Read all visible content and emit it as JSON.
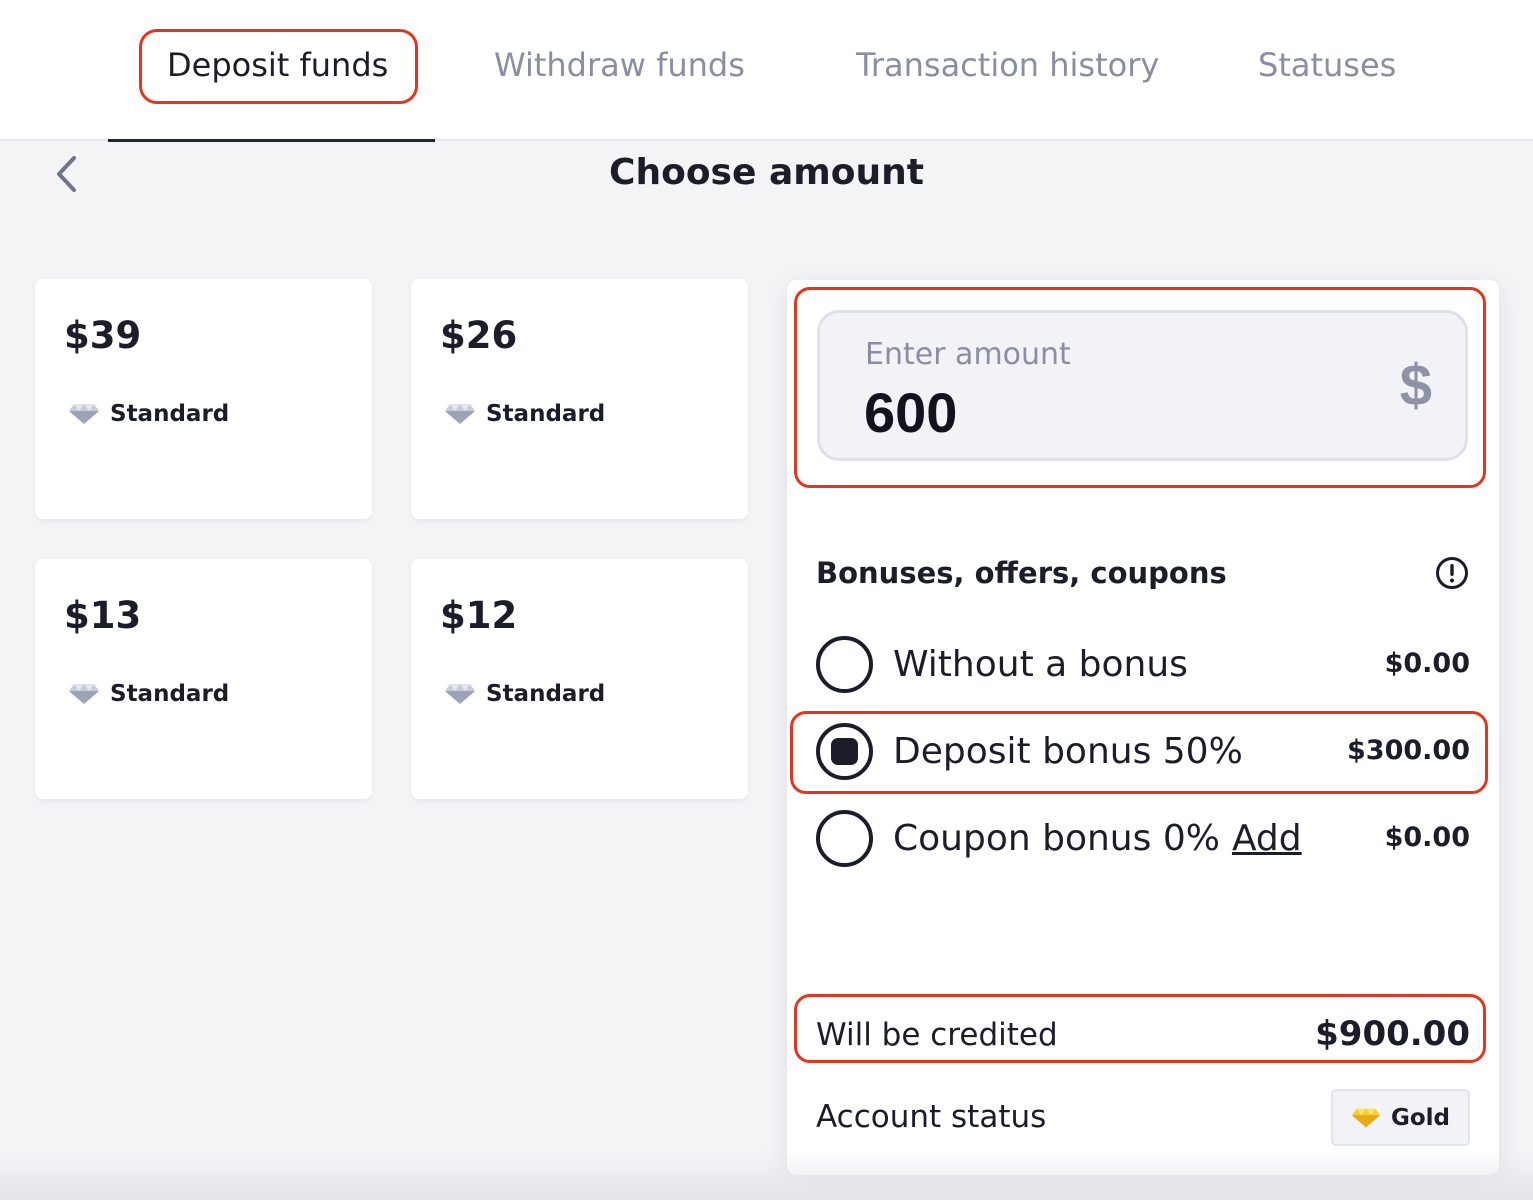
{
  "tabs": [
    {
      "label": "Deposit funds",
      "active": true
    },
    {
      "label": "Withdraw funds",
      "active": false
    },
    {
      "label": "Transaction history",
      "active": false
    },
    {
      "label": "Statuses",
      "active": false
    }
  ],
  "header": {
    "title": "Choose amount",
    "back_icon": "chevron-left-icon"
  },
  "amount_cards": [
    {
      "amount": "$39",
      "tier": "Standard",
      "icon": "diamond-icon"
    },
    {
      "amount": "$26",
      "tier": "Standard",
      "icon": "diamond-icon"
    },
    {
      "amount": "$13",
      "tier": "Standard",
      "icon": "diamond-icon"
    },
    {
      "amount": "$12",
      "tier": "Standard",
      "icon": "diamond-icon"
    }
  ],
  "amount_input": {
    "label": "Enter amount",
    "value": "600",
    "currency_symbol": "$"
  },
  "bonuses": {
    "heading": "Bonuses, offers, coupons",
    "info_icon": "info-icon",
    "options": [
      {
        "label": "Without a bonus",
        "amount": "$0.00",
        "selected": false
      },
      {
        "label": "Deposit bonus 50%",
        "amount": "$300.00",
        "selected": true
      },
      {
        "label": "Coupon bonus 0%",
        "link": "Add",
        "amount": "$0.00",
        "selected": false
      }
    ]
  },
  "summary": {
    "credited_label": "Will be credited",
    "credited_value": "$900.00",
    "status_label": "Account status",
    "status_value": "Gold",
    "status_icon": "gold-diamond-icon"
  },
  "colors": {
    "highlight": "#e8341c",
    "text": "#1b1d29",
    "muted": "#8a8ea3",
    "background": "#f4f4f7",
    "gold": "#f5c518"
  }
}
